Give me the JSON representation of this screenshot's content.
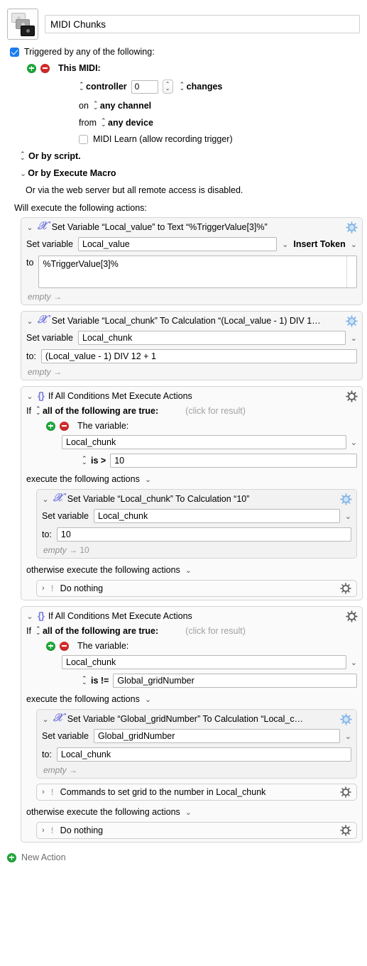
{
  "macro": {
    "icon_name": "stacked-windows-icon",
    "name": "MIDI Chunks"
  },
  "trigger": {
    "enabled_label": "Triggered by any of the following:",
    "this_midi_label": "This MIDI:",
    "controller_label": "controller",
    "controller_value": "0",
    "changes_label": "changes",
    "on_label": "on",
    "channel_value": "any channel",
    "from_label": "from",
    "device_value": "any device",
    "midi_learn_label": "MIDI Learn (allow recording trigger)",
    "or_by_script": "Or by script.",
    "or_by_execute_macro": "Or by Execute Macro",
    "web_server_note": "Or via the web server but all remote access is disabled."
  },
  "will_execute_label": "Will execute the following actions:",
  "actions": [
    {
      "icon": "set-variable-icon",
      "title": "Set Variable “Local_value” to Text “%TriggerValue[3]%”",
      "set_variable_label": "Set variable",
      "variable_name": "Local_value",
      "insert_token_label": "Insert Token",
      "to_label": "to",
      "to_value": "%TriggerValue[3]%",
      "result_label": "empty",
      "result_arrow": "→",
      "result_value": ""
    },
    {
      "icon": "set-variable-icon",
      "title": "Set Variable “Local_chunk” To Calculation “(Local_value - 1) DIV 1…",
      "set_variable_label": "Set variable",
      "variable_name": "Local_chunk",
      "to_label": "to:",
      "to_value": "(Local_value - 1) DIV 12 + 1",
      "result_label": "empty",
      "result_arrow": "→",
      "result_value": ""
    }
  ],
  "if_blocks": [
    {
      "title": "If All Conditions Met Execute Actions",
      "if_label": "If",
      "all_label": "all of the following are true:",
      "click_for_result": "(click for result)",
      "the_variable_label": "The variable:",
      "condition_variable": "Local_chunk",
      "operator": "is >",
      "operand": "10",
      "execute_label": "execute the following actions",
      "then_action": {
        "icon": "set-variable-icon",
        "title": "Set Variable “Local_chunk” To Calculation “10”",
        "set_variable_label": "Set variable",
        "variable_name": "Local_chunk",
        "to_label": "to:",
        "to_value": "10",
        "result_label": "empty",
        "result_arrow": "→",
        "result_value": "10"
      },
      "otherwise_label": "otherwise execute the following actions",
      "else_rows": [
        {
          "label": "Do nothing"
        }
      ]
    },
    {
      "title": "If All Conditions Met Execute Actions",
      "if_label": "If",
      "all_label": "all of the following are true:",
      "click_for_result": "(click for result)",
      "the_variable_label": "The variable:",
      "condition_variable": "Local_chunk",
      "operator": "is !=",
      "operand": "Global_gridNumber",
      "execute_label": "execute the following actions",
      "then_action": {
        "icon": "set-variable-icon",
        "title": "Set Variable “Global_gridNumber” To Calculation “Local_c…",
        "set_variable_label": "Set variable",
        "variable_name": "Global_gridNumber",
        "to_label": "to:",
        "to_value": "Local_chunk",
        "result_label": "empty",
        "result_arrow": "→",
        "result_value": ""
      },
      "then_extra_row": {
        "label": "Commands to set grid to the number in Local_chunk"
      },
      "otherwise_label": "otherwise execute the following actions",
      "else_rows": [
        {
          "label": "Do nothing"
        }
      ]
    }
  ],
  "new_action_label": "New Action",
  "colors": {
    "accent_blue": "#1a7cf0",
    "add_green": "#1fa83c",
    "remove_red": "#d32b2b",
    "action_icon_purple": "#7b7fe0",
    "gear_active_blue": "#7fb4e8"
  }
}
